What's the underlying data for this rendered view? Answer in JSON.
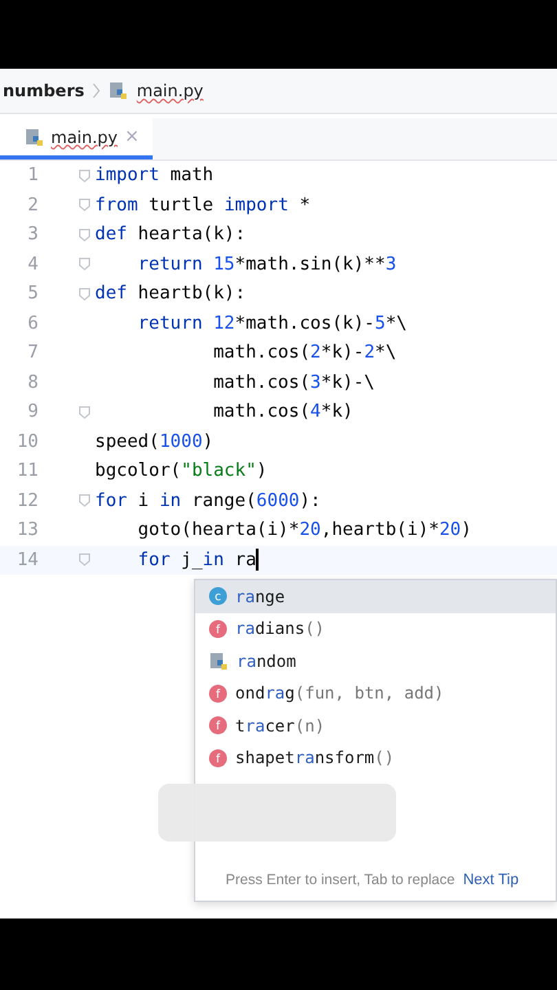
{
  "breadcrumb": {
    "folder": "numbers",
    "file": "main.py"
  },
  "tabs": [
    {
      "label": "main.py",
      "close": "×",
      "selected": true
    }
  ],
  "lines": [
    {
      "number": "1",
      "fold": true,
      "tokens": [
        {
          "kind": "kw",
          "text": "import"
        },
        {
          "kind": "plain",
          "text": " math"
        }
      ]
    },
    {
      "number": "2",
      "fold": true,
      "tokens": [
        {
          "kind": "kw",
          "text": "from"
        },
        {
          "kind": "plain",
          "text": " turtle "
        },
        {
          "kind": "kw",
          "text": "import"
        },
        {
          "kind": "plain",
          "text": " *"
        }
      ]
    },
    {
      "number": "3",
      "fold": true,
      "tokens": [
        {
          "kind": "kw",
          "text": "def"
        },
        {
          "kind": "plain",
          "text": " hearta(k):"
        }
      ]
    },
    {
      "number": "4",
      "fold": true,
      "tokens": [
        {
          "kind": "kw",
          "text": "    return"
        },
        {
          "kind": "num",
          "text": " 15"
        },
        {
          "kind": "plain",
          "text": "*math.sin(k)**"
        },
        {
          "kind": "num",
          "text": "3"
        }
      ]
    },
    {
      "number": "5",
      "fold": true,
      "tokens": [
        {
          "kind": "kw",
          "text": "def"
        },
        {
          "kind": "plain",
          "text": " heartb(k):"
        }
      ]
    },
    {
      "number": "6",
      "fold": false,
      "tokens": [
        {
          "kind": "kw",
          "text": "    return"
        },
        {
          "kind": "num",
          "text": " 12"
        },
        {
          "kind": "plain",
          "text": "*math.cos(k)-"
        },
        {
          "kind": "num",
          "text": "5"
        },
        {
          "kind": "plain",
          "text": "*\\"
        }
      ]
    },
    {
      "number": "7",
      "fold": false,
      "tokens": [
        {
          "kind": "plain",
          "text": "           math.cos("
        },
        {
          "kind": "num",
          "text": "2"
        },
        {
          "kind": "plain",
          "text": "*k)-"
        },
        {
          "kind": "num",
          "text": "2"
        },
        {
          "kind": "plain",
          "text": "*\\"
        }
      ]
    },
    {
      "number": "8",
      "fold": false,
      "tokens": [
        {
          "kind": "plain",
          "text": "           math.cos("
        },
        {
          "kind": "num",
          "text": "3"
        },
        {
          "kind": "plain",
          "text": "*k)-\\"
        }
      ]
    },
    {
      "number": "9",
      "fold": true,
      "tokens": [
        {
          "kind": "plain",
          "text": "           math.cos("
        },
        {
          "kind": "num",
          "text": "4"
        },
        {
          "kind": "plain",
          "text": "*k)"
        }
      ]
    },
    {
      "number": "10",
      "fold": false,
      "tokens": [
        {
          "kind": "plain",
          "text": "speed("
        },
        {
          "kind": "num",
          "text": "1000"
        },
        {
          "kind": "plain",
          "text": ")"
        }
      ]
    },
    {
      "number": "11",
      "fold": false,
      "tokens": [
        {
          "kind": "plain",
          "text": "bgcolor("
        },
        {
          "kind": "str",
          "text": "\"black\""
        },
        {
          "kind": "plain",
          "text": ")"
        }
      ]
    },
    {
      "number": "12",
      "fold": true,
      "tokens": [
        {
          "kind": "kw",
          "text": "for"
        },
        {
          "kind": "plain",
          "text": " i "
        },
        {
          "kind": "kw",
          "text": "in"
        },
        {
          "kind": "plain",
          "text": " range("
        },
        {
          "kind": "num",
          "text": "6000"
        },
        {
          "kind": "plain",
          "text": "):"
        }
      ]
    },
    {
      "number": "13",
      "fold": false,
      "tokens": [
        {
          "kind": "plain",
          "text": "    goto(hearta(i)*"
        },
        {
          "kind": "num",
          "text": "20"
        },
        {
          "kind": "plain",
          "text": ",heartb(i)*"
        },
        {
          "kind": "num",
          "text": "20"
        },
        {
          "kind": "plain",
          "text": ")"
        }
      ]
    },
    {
      "number": "14",
      "fold": true,
      "cursor": true,
      "tokens": [
        {
          "kind": "kw",
          "text": "    for"
        },
        {
          "kind": "plain",
          "text": " j_"
        },
        {
          "kind": "kw",
          "text": "in"
        },
        {
          "kind": "plain",
          "text": " ra"
        }
      ]
    }
  ],
  "completion": {
    "items": [
      {
        "kind": "class",
        "badge": "c",
        "match": "ra",
        "post": "nge",
        "selected": true
      },
      {
        "kind": "function",
        "badge": "f",
        "match": "ra",
        "post": "dians",
        "args": "()",
        "selected": false
      },
      {
        "kind": "module",
        "match": "ra",
        "post": "ndom",
        "selected": false
      },
      {
        "kind": "function",
        "badge": "f",
        "pre": "ond",
        "match": "ra",
        "post": "g",
        "args": "(fun, btn, add)",
        "selected": false
      },
      {
        "kind": "function",
        "badge": "f",
        "pre": "t",
        "match": "ra",
        "post": "cer",
        "args": "(n)",
        "selected": false
      },
      {
        "kind": "function",
        "badge": "f",
        "pre": "shapet",
        "match": "ra",
        "post": "nsform",
        "args": "()",
        "selected": false
      }
    ],
    "hint": "Press Enter to insert, Tab to replace",
    "tip": "Next Tip"
  }
}
